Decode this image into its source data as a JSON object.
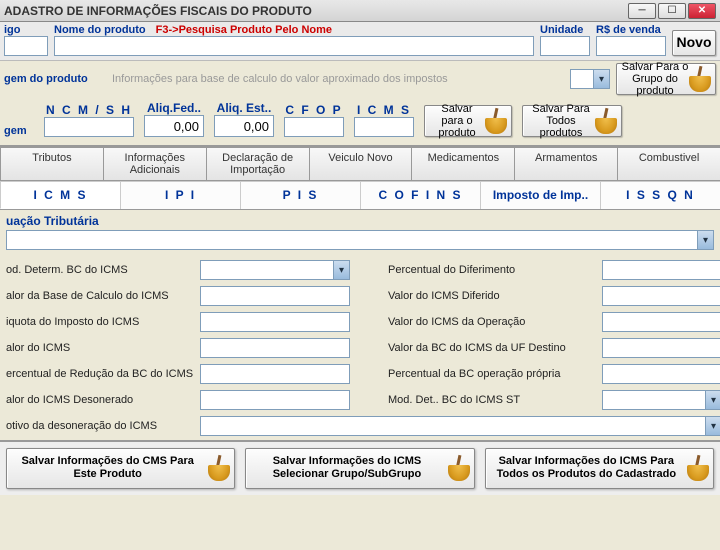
{
  "window": {
    "title": "ADASTRO DE INFORMAÇÕES FISCAIS DO PRODUTO"
  },
  "top": {
    "codigo_label": "igo",
    "nome_label": "Nome do produto",
    "pesquisa_hint": "F3->Pesquisa Produto Pelo Nome",
    "unidade_label": "Unidade",
    "preco_label": "R$ de venda",
    "novo": "Novo"
  },
  "section": {
    "origem_produto": "gem  do produto",
    "hint": "Informações para base de calculo do valor aproximado dos impostos",
    "origem_label": "gem"
  },
  "cols": {
    "ncm": "N  C M / S  H",
    "aliq_fed": "Aliq.Fed..",
    "aliq_est": "Aliq. Est..",
    "cfop": "C F O P",
    "icms": "I C M S"
  },
  "vals": {
    "aliq_fed": "0,00",
    "aliq_est": "0,00"
  },
  "sidebtns": {
    "grupo": "Salvar Para o Grupo do produto",
    "produto": "Salvar  para o produto",
    "todos": "Salvar Para Todos produtos"
  },
  "tabsA": [
    "Tributos",
    "Informações Adicionais",
    "Declaração de Importação",
    "Veiculo Novo",
    "Medicamentos",
    "Armamentos",
    "Combustivel"
  ],
  "tabsB": [
    "I C M S",
    "I  P  I",
    "P  I  S",
    "C O F I N S",
    "Imposto de Imp..",
    "I  S  S  Q  N"
  ],
  "sub": {
    "situacao": "uação Tributária"
  },
  "fields": {
    "l1": "od. Determ. BC do ICMS",
    "r1": "Percentual do Diferimento",
    "l2": "alor da Base de Calculo do ICMS",
    "r2": "Valor do ICMS Diferido",
    "l3": "iquota do Imposto do ICMS",
    "r3": "Valor do ICMS da Operação",
    "l4": "alor do ICMS",
    "r4": "Valor da BC do ICMS da UF Destino",
    "l5": "ercentual de Redução da BC do ICMS",
    "r5": "Percentual da BC operação própria",
    "l6": "alor do ICMS Desonerado",
    "r6": "Mod. Det.. BC do ICMS ST",
    "l7": "otivo da desoneração do ICMS"
  },
  "bottom": {
    "b1": "Salvar Informações do CMS Para Este Produto",
    "b2": "Salvar Informações do ICMS Selecionar Grupo/SubGrupo",
    "b3": "Salvar Informações do ICMS Para Todos os Produtos do Cadastrado"
  }
}
